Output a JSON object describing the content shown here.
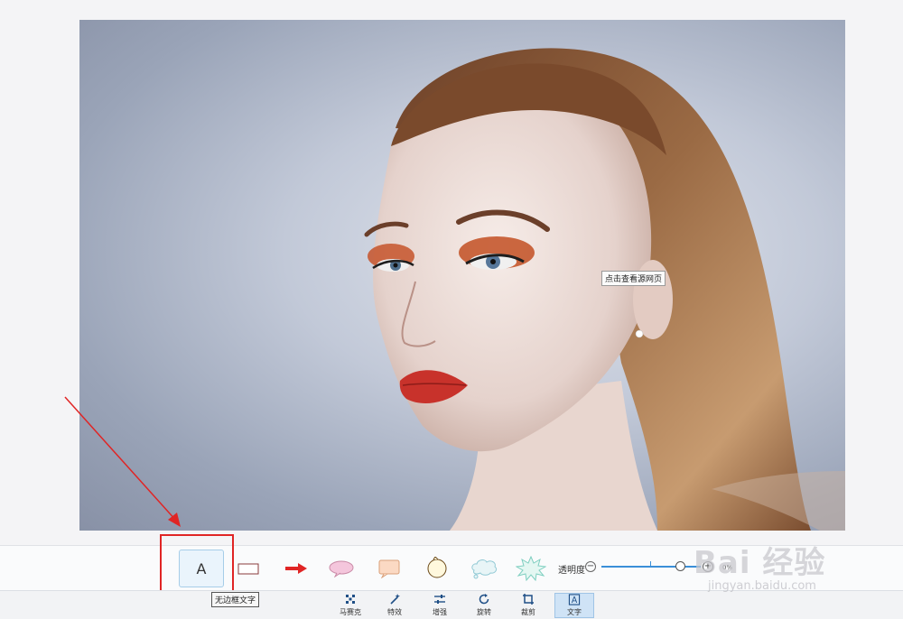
{
  "photo": {
    "description_icon": "portrait-photo",
    "tooltip": "点击查看源网页"
  },
  "toolbar": {
    "tools": [
      {
        "name": "text-no-border",
        "label": "A"
      },
      {
        "name": "rectangle"
      },
      {
        "name": "arrow"
      },
      {
        "name": "ellipse-bubble"
      },
      {
        "name": "rect-bubble"
      },
      {
        "name": "round-bubble"
      },
      {
        "name": "cloud-bubble"
      },
      {
        "name": "burst-bubble"
      }
    ],
    "opacity_label": "透明度",
    "opacity_minus": "−",
    "opacity_plus": "+",
    "opacity_value": "0%",
    "opacity_level": 0.8
  },
  "tool_tooltip": "无边框文字",
  "bottom": {
    "buttons": [
      {
        "label": "马赛克",
        "icon": "mosaic-icon"
      },
      {
        "label": "特效",
        "icon": "magic-wand-icon"
      },
      {
        "label": "增强",
        "icon": "sliders-icon"
      },
      {
        "label": "旋转",
        "icon": "rotate-icon"
      },
      {
        "label": "裁剪",
        "icon": "crop-icon"
      },
      {
        "label": "文字",
        "icon": "text-icon"
      }
    ]
  },
  "watermark": {
    "logo": "Bai 经验",
    "url": "jingyan.baidu.com"
  },
  "colors": {
    "highlight": "#e02525",
    "accent": "#3a8fd8",
    "bubble_pink": "#f4c6dc",
    "bubble_orange": "#fbd9c3"
  }
}
